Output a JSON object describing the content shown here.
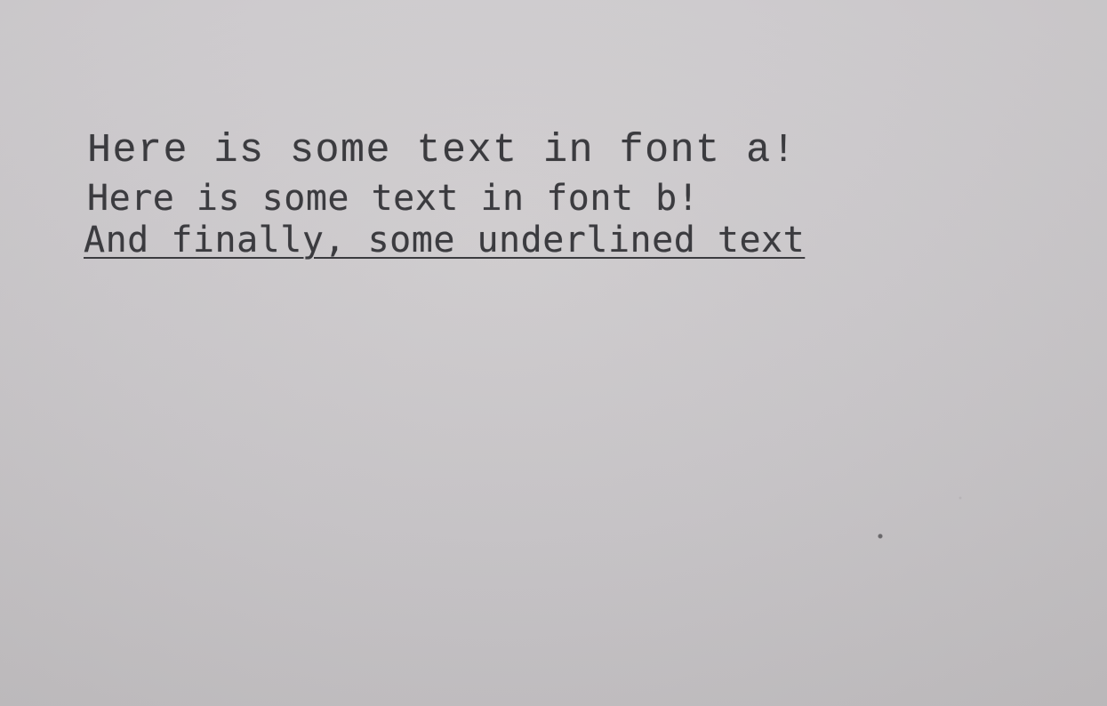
{
  "document": {
    "lines": [
      "Here is some text in font a!",
      "Here is some text in font b!",
      "And finally, some underlined text"
    ]
  }
}
